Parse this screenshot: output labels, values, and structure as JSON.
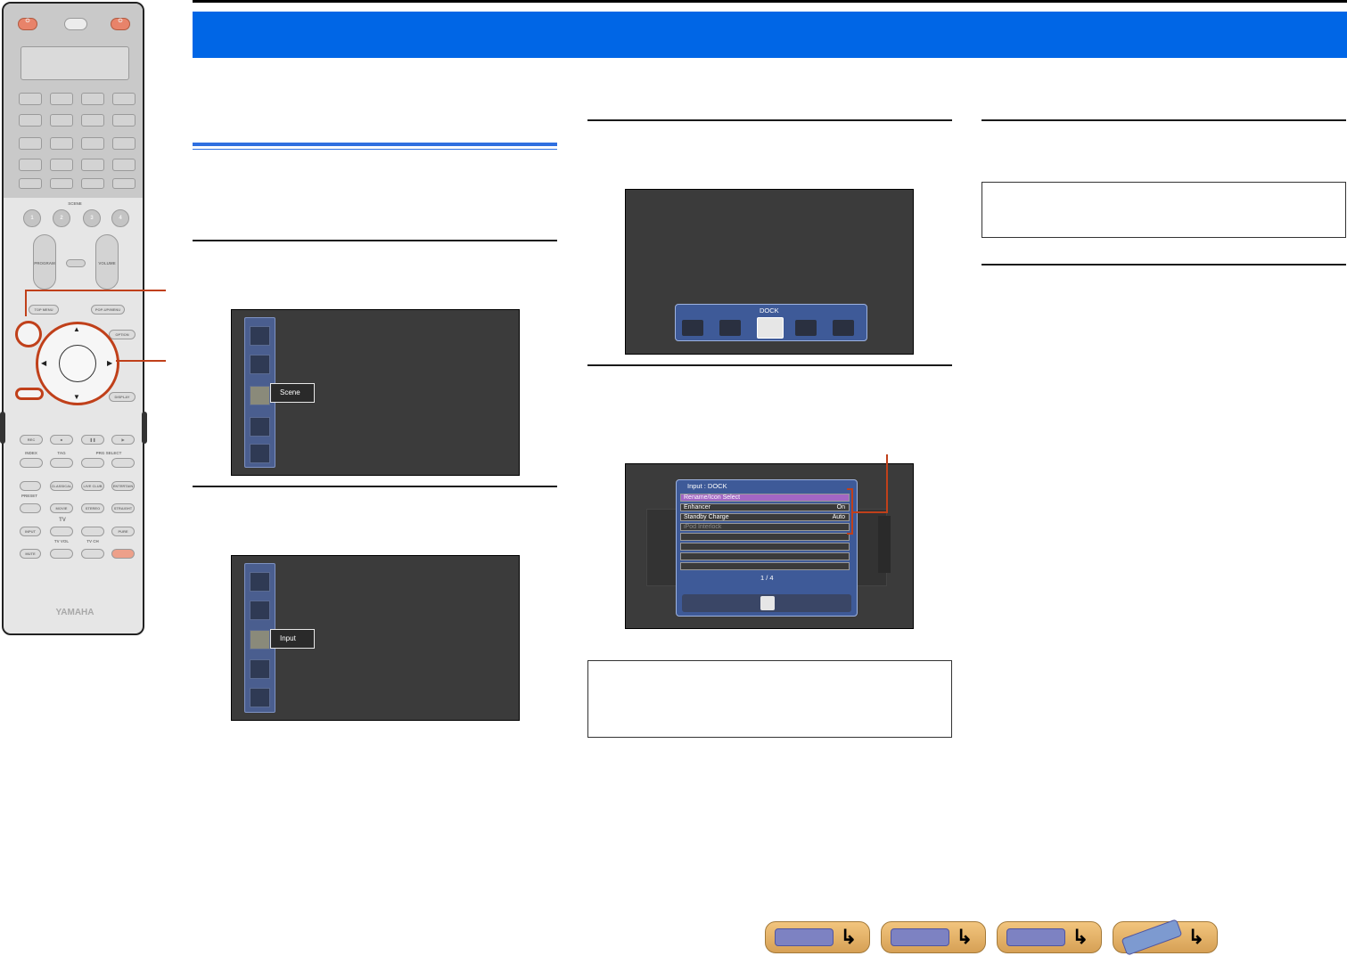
{
  "remote": {
    "brand": "YAMAHA",
    "scene_label": "SCENE",
    "scene_keys": [
      "1",
      "2",
      "3",
      "4"
    ],
    "program_label": "PROGRAM",
    "volume_label": "VOLUME",
    "top_menu": "TOP MENU",
    "popup_menu": "POP-UP/MENU",
    "option": "OPTION",
    "display": "DISPLAY",
    "transport": [
      "REC",
      "■",
      "❚❚",
      "▶"
    ],
    "transport_labels": [
      "INDEX",
      "TAG",
      "PRG SELECT"
    ],
    "sound_keys": [
      "CLASSICAL",
      "LIVE CLUB",
      "ENTERTAIN"
    ],
    "sound_keys2": [
      "MOVIE",
      "STEREO",
      "STRAIGHT"
    ],
    "preset": "PRESET",
    "tv_label": "TV",
    "tv_keys": [
      "INPUT",
      "MUTE",
      "TV VOL",
      "TV CH",
      "PURE DIRECT"
    ]
  },
  "osd_scene": {
    "selected_label": "Scene"
  },
  "osd_input": {
    "selected_label": "Input"
  },
  "osd_dock": {
    "panel_title": "DOCK"
  },
  "osd_menu": {
    "panel_title": "Input : DOCK",
    "rows": [
      {
        "label": "Rename/Icon Select",
        "value": ""
      },
      {
        "label": "Enhancer",
        "value": "On"
      },
      {
        "label": "Standby Charge",
        "value": "Auto"
      },
      {
        "label": "iPod Interlock",
        "value": ""
      }
    ],
    "page": "1 / 4"
  },
  "colors": {
    "header_blue": "#0066e6",
    "callout_orange": "#c0401a",
    "osd_blue": "#3e5a98",
    "highlight_purple": "#a266c4"
  }
}
